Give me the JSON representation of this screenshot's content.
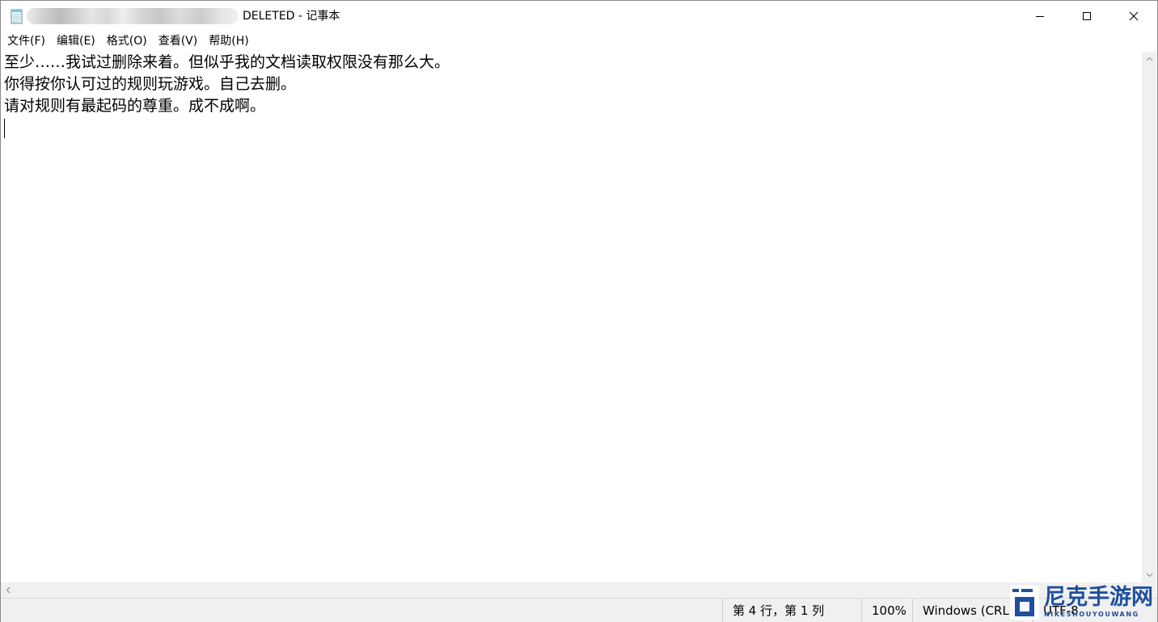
{
  "window": {
    "title": "DELETED - 记事本",
    "icon": "notepad-icon"
  },
  "caption_buttons": {
    "minimize_icon": "minimize-icon",
    "maximize_icon": "maximize-icon",
    "close_icon": "close-icon"
  },
  "menu": {
    "items": [
      {
        "label": "文件(F)"
      },
      {
        "label": "编辑(E)"
      },
      {
        "label": "格式(O)"
      },
      {
        "label": "查看(V)"
      },
      {
        "label": "帮助(H)"
      }
    ]
  },
  "editor": {
    "lines": [
      "至少……我试过删除来着。但似乎我的文档读取权限没有那么大。",
      "你得按你认可过的规则玩游戏。自己去删。",
      "请对规则有最起码的尊重。成不成啊。",
      ""
    ]
  },
  "statusbar": {
    "position": "第 4 行，第 1 列",
    "zoom": "100%",
    "line_ending": "Windows (CRLF)",
    "encoding": "UTF-8"
  },
  "watermark": {
    "name": "尼克手游网",
    "sub": "NIKESHOUYOUWANG"
  },
  "colors": {
    "watermark": "#1f4f9f",
    "chrome": "#f0f0f0"
  }
}
